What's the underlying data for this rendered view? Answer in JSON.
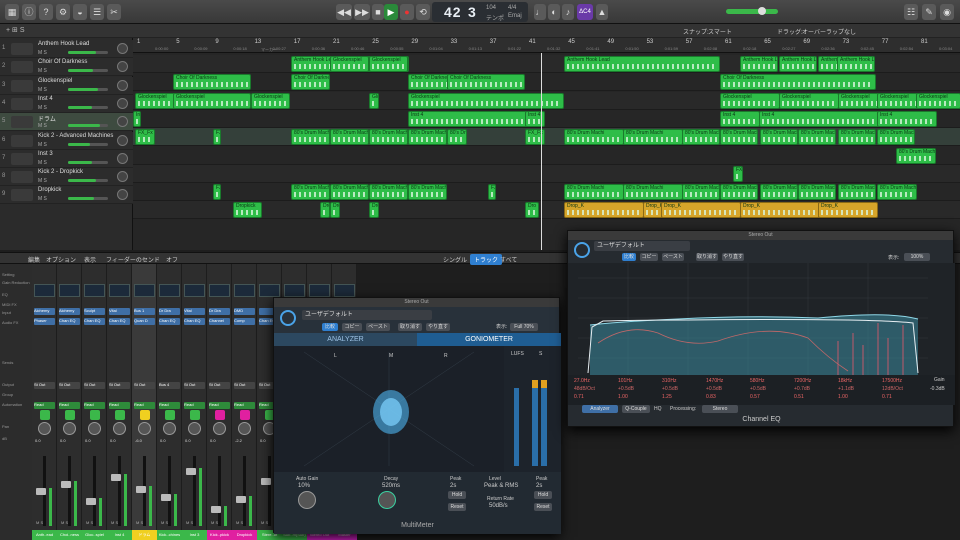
{
  "control_bar": {
    "position_bars": "42",
    "position_beats": "3",
    "tempo": "104",
    "tempo_label": "テンポ",
    "signature": "4/4",
    "key": "Emaj",
    "kbd": "ΔC4"
  },
  "tracks_header": {
    "snap_label": "スナップ:",
    "snap_value": "スマート",
    "drag_label": "ドラッグ:",
    "drag_value": "オーバーラップなし"
  },
  "ruler": {
    "bars": [
      "1",
      "5",
      "9",
      "13",
      "17",
      "21",
      "25",
      "29",
      "33",
      "37",
      "41",
      "45",
      "49",
      "53",
      "57",
      "61",
      "65",
      "69",
      "73",
      "77",
      "81"
    ],
    "times": [
      "0:00:00",
      "0:00:09",
      "0:00:18",
      "0:00:27",
      "0:00:36",
      "0:00:46",
      "0:00:55",
      "0:01:04",
      "0:01:13",
      "0:01:22",
      "0:01:32",
      "0:01:41",
      "0:01:50",
      "0:01:59",
      "0:02:08",
      "0:02:18",
      "0:02:27",
      "0:02:36",
      "0:02:45",
      "0:02:54",
      "0:03:04"
    ],
    "marker": "マーカー"
  },
  "tracks": [
    {
      "num": "1",
      "name": "Anthem Hook Lead",
      "ms": "M  S"
    },
    {
      "num": "2",
      "name": "Choir Of Darkness",
      "ms": "M  S"
    },
    {
      "num": "3",
      "name": "Glockenspiel",
      "ms": "M  S"
    },
    {
      "num": "4",
      "name": "Inst 4",
      "ms": "M  S"
    },
    {
      "num": "5",
      "name": "ドラム",
      "ms": "M  S"
    },
    {
      "num": "6",
      "name": "Kick 2 - Advanced Machines",
      "ms": "M  S"
    },
    {
      "num": "7",
      "name": "Inst 3",
      "ms": "M  S"
    },
    {
      "num": "8",
      "name": "Kick 2 - Dropkick",
      "ms": "M  S"
    },
    {
      "num": "9",
      "name": "Dropkick",
      "ms": "M  S"
    }
  ],
  "regions": {
    "anthem": "Anthem Hook Lead",
    "choir": "Choir Of Darkness",
    "glock": "Glockenspiel",
    "inst4": "Inst 4",
    "fx": "FX_Fx",
    "drum": "80's Drum Machi",
    "dropkick": "Dropkick",
    "drop_short": "Dro",
    "dropk": "Drop_K"
  },
  "mixer_header": {
    "edit": "編集",
    "options": "オプション",
    "view": "表示",
    "feeder": "フィーダーのセンド",
    "off": "オフ",
    "single": "シングル",
    "tracks": "トラック",
    "all": "すべて"
  },
  "mixer_labels": [
    "Setting",
    "Gain Reduction",
    "EQ",
    "MIDI FX",
    "Input",
    "Audio FX",
    "Sends",
    "Output",
    "Group",
    "Automation",
    "",
    "Pan",
    "dB"
  ],
  "channels": [
    {
      "name": "Anth..ead",
      "color": "#3bb84a",
      "input": "Alchemy",
      "fx": "Phaser",
      "out": "St Out",
      "auto": "Read",
      "db": "0.0"
    },
    {
      "name": "Choi..ness",
      "color": "#3bb84a",
      "input": "Alchemy",
      "fx": "Chan EQ",
      "out": "St Out",
      "auto": "Read",
      "db": "0.0"
    },
    {
      "name": "Gloc..spiel",
      "color": "#3bb84a",
      "input": "Sculpt",
      "fx": "Chan EQ",
      "out": "St Out",
      "auto": "Read",
      "db": "0.0"
    },
    {
      "name": "Inst 4",
      "color": "#3bb84a",
      "input": "Vital",
      "fx": "Chan EQ",
      "out": "St Out",
      "auto": "Read",
      "db": "0.0"
    },
    {
      "name": "ドラム",
      "color": "#f0d020",
      "input": "Bus 1",
      "fx": "Quan D",
      "out": "St Out",
      "auto": "Read",
      "db": "-6.0"
    },
    {
      "name": "Kick..chines",
      "color": "#3bb84a",
      "input": "Dr Dra",
      "fx": "Chan EQ",
      "out": "Bus 4",
      "auto": "Read",
      "db": "0.0"
    },
    {
      "name": "Inst 3",
      "color": "#3bb84a",
      "input": "Vital",
      "fx": "Chan EQ",
      "out": "St Out",
      "auto": "Read",
      "db": "0.0"
    },
    {
      "name": "Kick..pkick",
      "color": "#e020a0",
      "input": "Dr Dra",
      "fx": "Channel",
      "out": "St Out",
      "auto": "Read",
      "db": "0.0"
    },
    {
      "name": "Dropkick",
      "color": "#e020a0",
      "input": "DMD",
      "fx": "Comp",
      "out": "St Out",
      "auto": "Read",
      "db": "-2.2"
    },
    {
      "name": "Stere..ut",
      "color": "#3bb84a",
      "input": "",
      "fx": "Chan EQ",
      "out": "St Out",
      "auto": "Read",
      "db": "0.0"
    },
    {
      "name": "Sub..m(Sub)",
      "color": "#3bb84a",
      "input": "",
      "fx": "",
      "out": "St Out",
      "auto": "Read",
      "db": "0.0"
    },
    {
      "name": "Stereo Out",
      "color": "#d020c0",
      "input": "",
      "fx": "",
      "out": "",
      "auto": "Read",
      "db": "-0.3"
    },
    {
      "name": "Master",
      "color": "#d020c0",
      "input": "",
      "fx": "",
      "out": "",
      "auto": "Read",
      "db": "0.0"
    }
  ],
  "multimeter": {
    "window_title": "Stereo Out",
    "preset": "ユーザデフォルト",
    "compare": "比較",
    "copy": "コピー",
    "paste": "ペースト",
    "undo": "取り消す",
    "redo": "やり直す",
    "view": "表示:",
    "view_value": "Full 70%",
    "tab_analyzer": "ANALYZER",
    "tab_goniometer": "GONIOMETER",
    "lufs": "LUFS",
    "s_label": "S",
    "l_label": "L",
    "r_label": "R",
    "m_label": "M",
    "auto_gain_label": "Auto Gain",
    "auto_gain": "10%",
    "decay_label": "Decay",
    "decay": "520ms",
    "peak_label": "Peak",
    "peak_value": "2s",
    "hold": "Hold",
    "reset": "Reset",
    "level_label": "Level",
    "level_value": "Peak & RMS",
    "return_rate_label": "Return Rate",
    "return_rate": "50dB/s",
    "peak2_label": "Peak",
    "peak2_value": "2s",
    "plugin_name": "MultiMeter"
  },
  "channel_eq": {
    "window_title": "Stereo Out",
    "preset": "ユーザデフォルト",
    "compare": "比較",
    "copy": "コピー",
    "paste": "ペースト",
    "undo": "取り消す",
    "redo": "やり直す",
    "view": "表示:",
    "view_value": "100%",
    "analyzer": "Analyzer",
    "analyzer_post": "POST",
    "q_couple": "Q-Couple",
    "hq": "HQ",
    "processing_label": "Processing:",
    "processing_value": "Stereo",
    "gain_label": "Gain",
    "gain_value": "-0.3dB",
    "plugin_name": "Channel EQ",
    "db_scale": [
      "+24",
      "+20",
      "+15",
      "+10",
      "+5",
      "0",
      "-5",
      "-10",
      "-15",
      "-20",
      "-25",
      "-30",
      "-35",
      "-40",
      "-45",
      "-50",
      "-55",
      "-60"
    ],
    "freq_scale": [
      "20",
      "30",
      "40",
      "60",
      "80",
      "100",
      "200",
      "300",
      "400",
      "600",
      "800",
      "1k",
      "2k",
      "3k",
      "4k",
      "6k",
      "8k",
      "10k",
      "20k"
    ],
    "bands": [
      {
        "freq": "27.0Hz",
        "gain": "48dB/Oct",
        "q": "0.71"
      },
      {
        "freq": "101Hz",
        "gain": "+0.5dB",
        "q": "1.00"
      },
      {
        "freq": "310Hz",
        "gain": "+0.5dB",
        "q": "1.25"
      },
      {
        "freq": "1470Hz",
        "gain": "+0.5dB",
        "q": "0.83"
      },
      {
        "freq": "580Hz",
        "gain": "+0.5dB",
        "q": "0.57"
      },
      {
        "freq": "7200Hz",
        "gain": "+0.7dB",
        "q": "0.51"
      },
      {
        "freq": "18kHz",
        "gain": "+1.1dB",
        "q": "1.00"
      },
      {
        "freq": "17500Hz",
        "gain": "12dB/Oct",
        "q": "0.71"
      }
    ]
  }
}
